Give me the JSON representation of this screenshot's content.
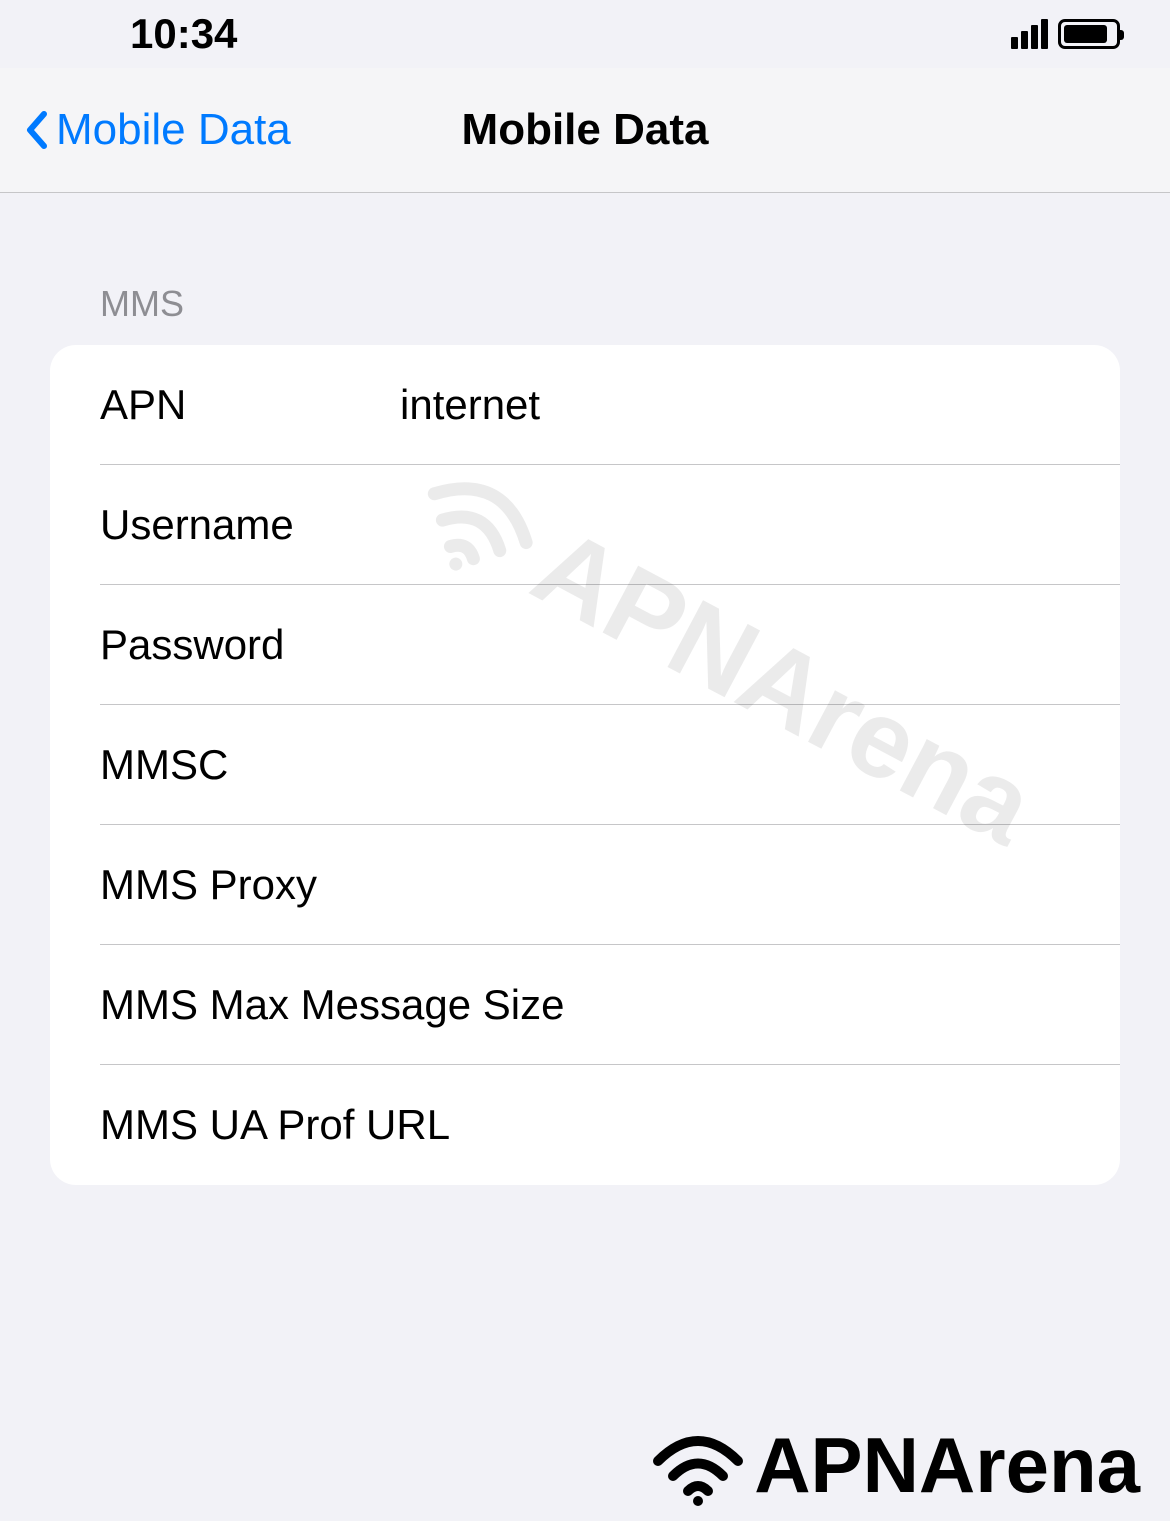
{
  "status_bar": {
    "time": "10:34"
  },
  "nav": {
    "back_label": "Mobile Data",
    "title": "Mobile Data"
  },
  "section": {
    "header": "MMS",
    "rows": [
      {
        "label": "APN",
        "value": "internet"
      },
      {
        "label": "Username",
        "value": ""
      },
      {
        "label": "Password",
        "value": ""
      },
      {
        "label": "MMSC",
        "value": ""
      },
      {
        "label": "MMS Proxy",
        "value": ""
      },
      {
        "label": "MMS Max Message Size",
        "value": ""
      },
      {
        "label": "MMS UA Prof URL",
        "value": ""
      }
    ]
  },
  "watermark_text": "APNArena",
  "footer_text": "APNArena"
}
